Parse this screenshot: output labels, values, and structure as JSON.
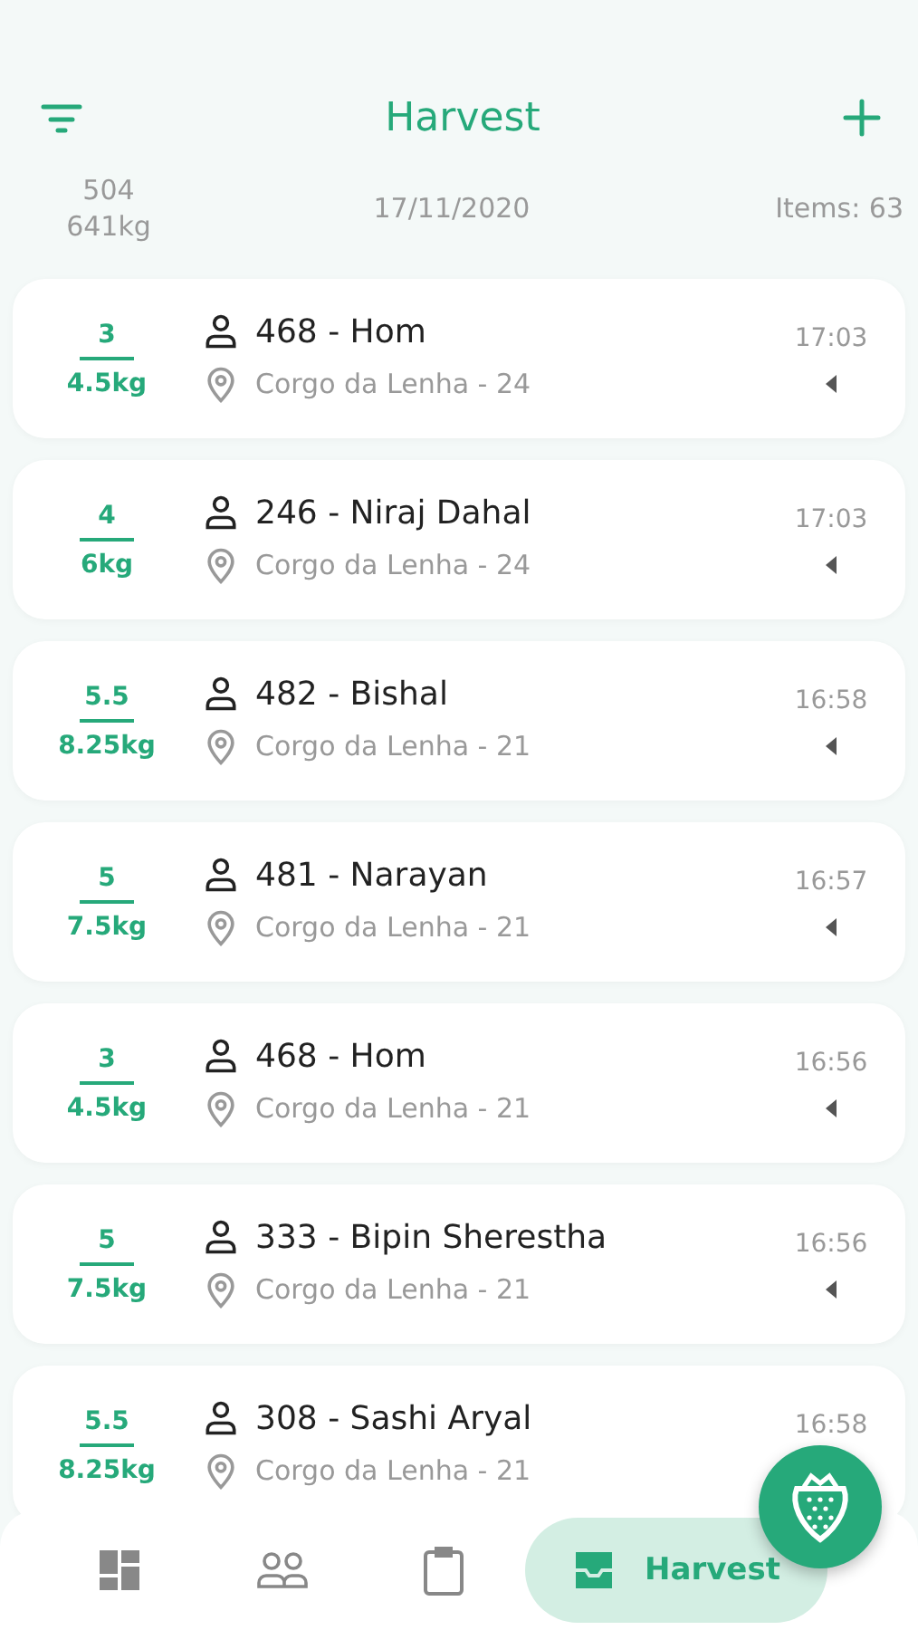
{
  "header": {
    "title": "Harvest"
  },
  "summary": {
    "count": "504",
    "weight": "641kg",
    "date": "17/11/2020",
    "items": "Items: 63"
  },
  "records": [
    {
      "quantity": "3",
      "weight": "4.5kg",
      "worker": "468 - Hom",
      "location": "Corgo da Lenha - 24",
      "time": "17:03"
    },
    {
      "quantity": "4",
      "weight": "6kg",
      "worker": "246 - Niraj Dahal",
      "location": "Corgo da Lenha - 24",
      "time": "17:03"
    },
    {
      "quantity": "5.5",
      "weight": "8.25kg",
      "worker": "482 - Bishal",
      "location": "Corgo da Lenha - 21",
      "time": "16:58"
    },
    {
      "quantity": "5",
      "weight": "7.5kg",
      "worker": "481 - Narayan",
      "location": "Corgo da Lenha - 21",
      "time": "16:57"
    },
    {
      "quantity": "3",
      "weight": "4.5kg",
      "worker": "468 - Hom",
      "location": "Corgo da Lenha - 21",
      "time": "16:56"
    },
    {
      "quantity": "5",
      "weight": "7.5kg",
      "worker": "333 - Bipin Sherestha",
      "location": "Corgo da Lenha - 21",
      "time": "16:56"
    },
    {
      "quantity": "5.5",
      "weight": "8.25kg",
      "worker": "308 - Sashi Aryal",
      "location": "Corgo da Lenha - 21",
      "time": "16:58",
      "caret": false
    }
  ],
  "tabs": [
    {
      "kind": "dashboard",
      "selected": false
    },
    {
      "kind": "people",
      "selected": false
    },
    {
      "kind": "clipboard",
      "selected": false
    },
    {
      "kind": "tray",
      "label": "Harvest",
      "selected": true
    }
  ]
}
